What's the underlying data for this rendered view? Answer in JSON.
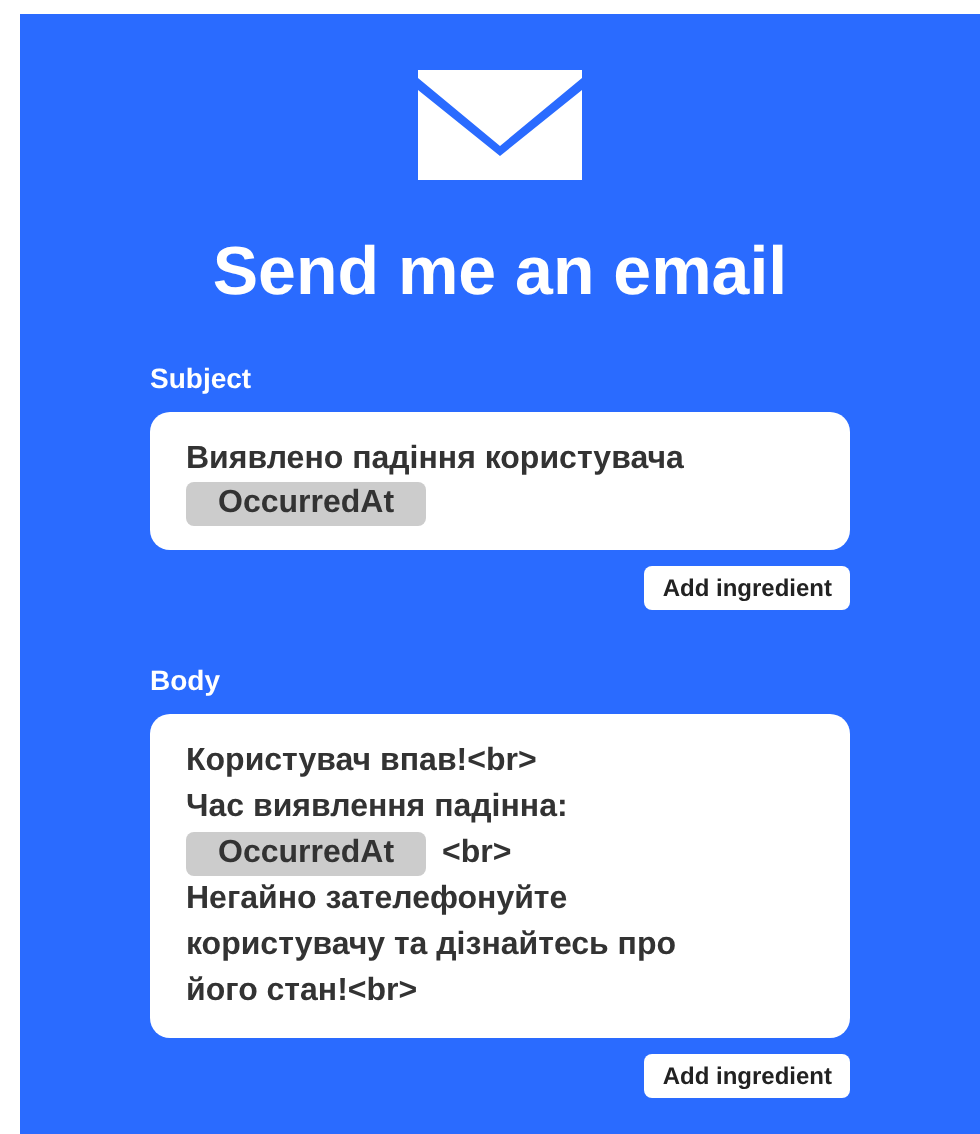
{
  "title": "Send me an email",
  "fields": [
    {
      "label": "Subject",
      "lines": [
        [
          {
            "kind": "text",
            "text": "Виявлено падіння користувача"
          }
        ],
        [
          {
            "kind": "ingredient",
            "text": "OccurredAt"
          }
        ]
      ],
      "button": "Add ingredient"
    },
    {
      "label": "Body",
      "lines": [
        [
          {
            "kind": "text",
            "text": "Користувач впав!<br>"
          }
        ],
        [
          {
            "kind": "text",
            "text": "Час виявлення падінна:"
          }
        ],
        [
          {
            "kind": "ingredient",
            "text": "OccurredAt"
          },
          {
            "kind": "text",
            "text": "<br>"
          }
        ],
        [
          {
            "kind": "text",
            "text": "Негайно зателефонуйте"
          }
        ],
        [
          {
            "kind": "text",
            "text": "користувачу та дізнайтесь про"
          }
        ],
        [
          {
            "kind": "text",
            "text": "його стан!<br>"
          }
        ]
      ],
      "button": "Add ingredient"
    }
  ]
}
